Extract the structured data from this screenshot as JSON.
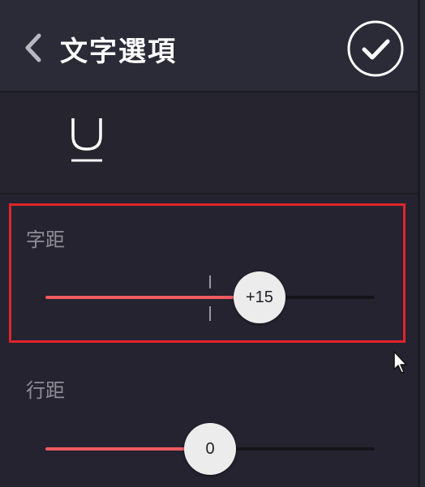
{
  "header": {
    "title": "文字選項",
    "back_icon": "chevron-left-icon",
    "confirm_icon": "check-circle-icon"
  },
  "style_row": {
    "underline_glyph": "U",
    "underline_icon": "underline-icon"
  },
  "letter_spacing": {
    "label": "字距",
    "value_label": "+15",
    "fill_fraction": 0.65,
    "default_fraction": 0.5
  },
  "line_spacing": {
    "label": "行距",
    "value_label": "0",
    "fill_fraction": 0.5
  },
  "colors": {
    "accent": "#ee5a5f",
    "highlight": "#e0242d",
    "background": "#24232f",
    "header": "#2b2a37"
  }
}
